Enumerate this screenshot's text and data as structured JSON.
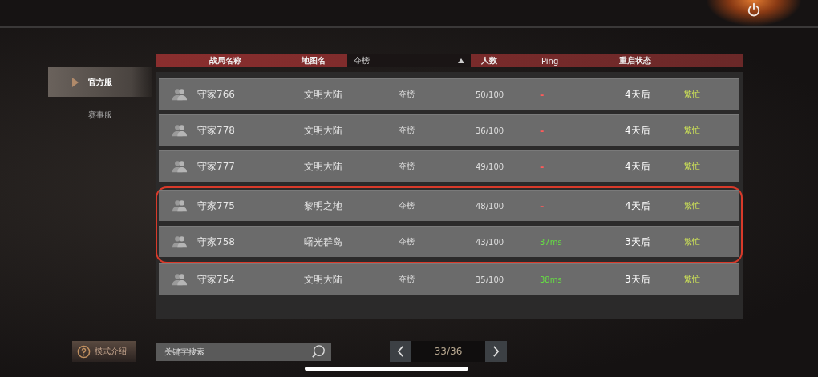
{
  "sidebar": {
    "items": [
      {
        "label": "官方服",
        "selected": true
      },
      {
        "label": "赛事服",
        "selected": false
      }
    ]
  },
  "table": {
    "columns": [
      "战局名称",
      "地图名"
    ],
    "filter": {
      "value": "夺榜"
    },
    "columns_right": [
      "人数",
      "Ping",
      "重启状态"
    ],
    "rows": [
      {
        "name": "守家766",
        "map": "文明大陆",
        "mode": "夺榜",
        "players": "50/100",
        "ping": "-",
        "ping_ok": false,
        "restart": "4天后",
        "status": "繁忙",
        "circled": false
      },
      {
        "name": "守家778",
        "map": "文明大陆",
        "mode": "夺榜",
        "players": "36/100",
        "ping": "-",
        "ping_ok": false,
        "restart": "4天后",
        "status": "繁忙",
        "circled": false
      },
      {
        "name": "守家777",
        "map": "文明大陆",
        "mode": "夺榜",
        "players": "49/100",
        "ping": "-",
        "ping_ok": false,
        "restart": "4天后",
        "status": "繁忙",
        "circled": false
      },
      {
        "name": "守家775",
        "map": "黎明之地",
        "mode": "夺榜",
        "players": "48/100",
        "ping": "-",
        "ping_ok": false,
        "restart": "4天后",
        "status": "繁忙",
        "circled": true
      },
      {
        "name": "守家758",
        "map": "曙光群岛",
        "mode": "夺榜",
        "players": "43/100",
        "ping": "37ms",
        "ping_ok": true,
        "restart": "3天后",
        "status": "繁忙",
        "circled": true
      },
      {
        "name": "守家754",
        "map": "文明大陆",
        "mode": "夺榜",
        "players": "35/100",
        "ping": "38ms",
        "ping_ok": true,
        "restart": "3天后",
        "status": "繁忙",
        "circled": false
      }
    ]
  },
  "mode_button": {
    "label": "模式介绍"
  },
  "search": {
    "placeholder": "关键字搜索"
  },
  "pager": {
    "page": "33/36"
  }
}
